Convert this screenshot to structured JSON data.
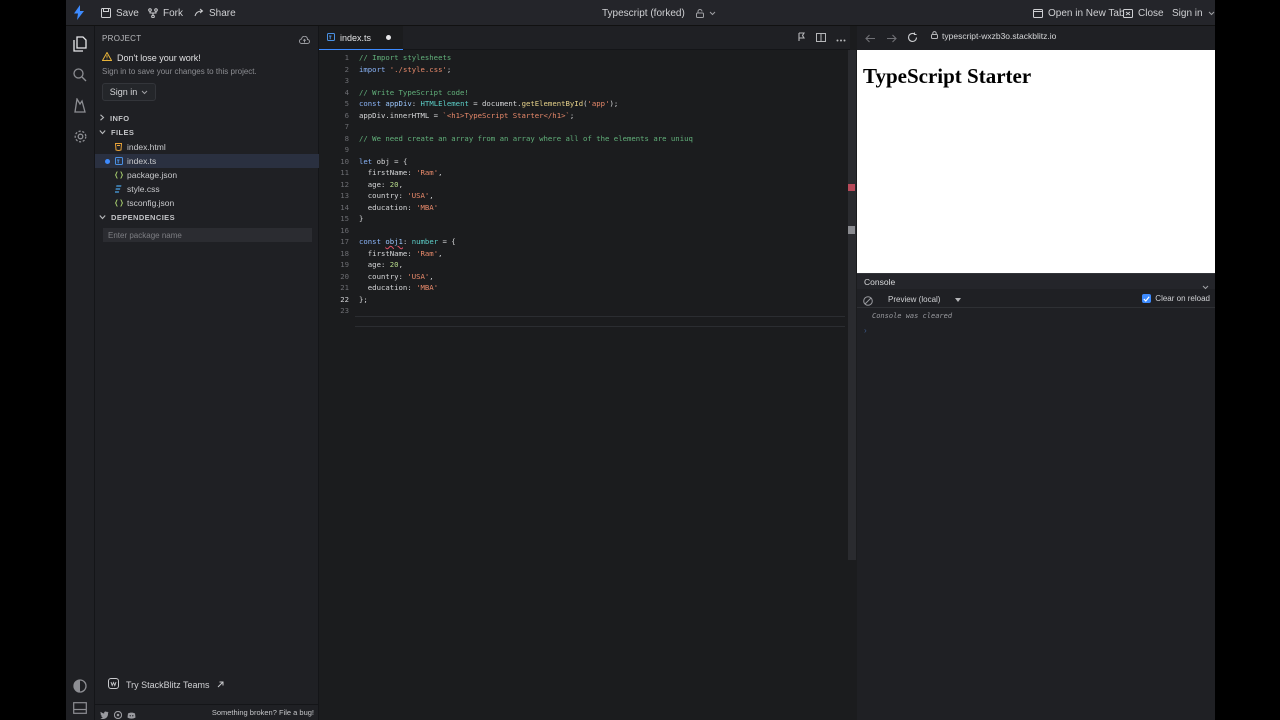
{
  "topbar": {
    "save": "Save",
    "fork": "Fork",
    "share": "Share",
    "title": "Typescript (forked)",
    "open_new_tab": "Open in New Tab",
    "close": "Close",
    "sign_in": "Sign in"
  },
  "sidebar": {
    "project_label": "PROJECT",
    "warning_title": "Don't lose your work!",
    "warning_sub": "Sign in to save your changes to this project.",
    "signin_button": "Sign in",
    "sections": {
      "info": "INFO",
      "files": "FILES",
      "dependencies": "DEPENDENCIES"
    },
    "files": [
      {
        "name": "index.html",
        "icon": "html-file-icon"
      },
      {
        "name": "index.ts",
        "icon": "ts-file-icon",
        "active": true
      },
      {
        "name": "package.json",
        "icon": "json-file-icon"
      },
      {
        "name": "style.css",
        "icon": "css-file-icon"
      },
      {
        "name": "tsconfig.json",
        "icon": "json-file-icon"
      }
    ],
    "package_placeholder": "Enter package name",
    "teams_link": "Try StackBlitz Teams",
    "bug_link": "Something broken? File a bug!"
  },
  "editor": {
    "tab_name": "index.ts",
    "current_line": 22,
    "line_numbers": [
      "1",
      "2",
      "3",
      "4",
      "5",
      "6",
      "7",
      "8",
      "9",
      "10",
      "11",
      "12",
      "13",
      "14",
      "15",
      "16",
      "17",
      "18",
      "19",
      "20",
      "21",
      "22",
      "23"
    ],
    "code": {
      "l1": "// Import stylesheets",
      "l2_kw": "import",
      "l2_str": "'./style.css'",
      "l2_end": ";",
      "l4": "// Write TypeScript code!",
      "l5_kw": "const",
      "l5_var": "appDiv",
      "l5_colon": ": ",
      "l5_type": "HTMLElement",
      "l5_eq": " = document.",
      "l5_fn": "getElementById",
      "l5_open": "(",
      "l5_str": "'app'",
      "l5_close": ");",
      "l6_a": "appDiv.innerHTML = ",
      "l6_str": "`<h1>TypeScript Starter</h1>`",
      "l6_end": ";",
      "l8": "// We need create an array from an array where all of the elements are uniuq",
      "l10_kw": "let",
      "l10_rest": " obj = {",
      "l11_a": "  firstName: ",
      "l11_str": "'Ram'",
      "l11_end": ",",
      "l12_a": "  age: ",
      "l12_num": "20",
      "l12_end": ",",
      "l13_a": "  country: ",
      "l13_str": "'USA'",
      "l13_end": ",",
      "l14_a": "  education: ",
      "l14_str": "'MBA'",
      "l15": "}",
      "l17_kw": "const",
      "l17_sp": " ",
      "l17_var": "obj1",
      "l17_colon": ": ",
      "l17_type": "number",
      "l17_end": " = {",
      "l18_a": "  firstName: ",
      "l18_str": "'Ram'",
      "l18_end": ",",
      "l19_a": "  age: ",
      "l19_num": "20",
      "l19_end": ",",
      "l20_a": "  country: ",
      "l20_str": "'USA'",
      "l20_end": ",",
      "l21_a": "  education: ",
      "l21_str": "'MBA'",
      "l22": "};"
    }
  },
  "preview": {
    "url": "typescript-wxzb3o.stackblitz.io",
    "heading": "TypeScript Starter",
    "console_title": "Console",
    "context_select": "Preview (local)",
    "clear_on_reload": "Clear on reload",
    "clear_on_reload_checked": true,
    "cleared_message": "Console was cleared",
    "prompt": "›"
  },
  "colors": {
    "accent": "#3d8bff",
    "bolt": "#3d8bff",
    "warning": "#e8b339"
  }
}
